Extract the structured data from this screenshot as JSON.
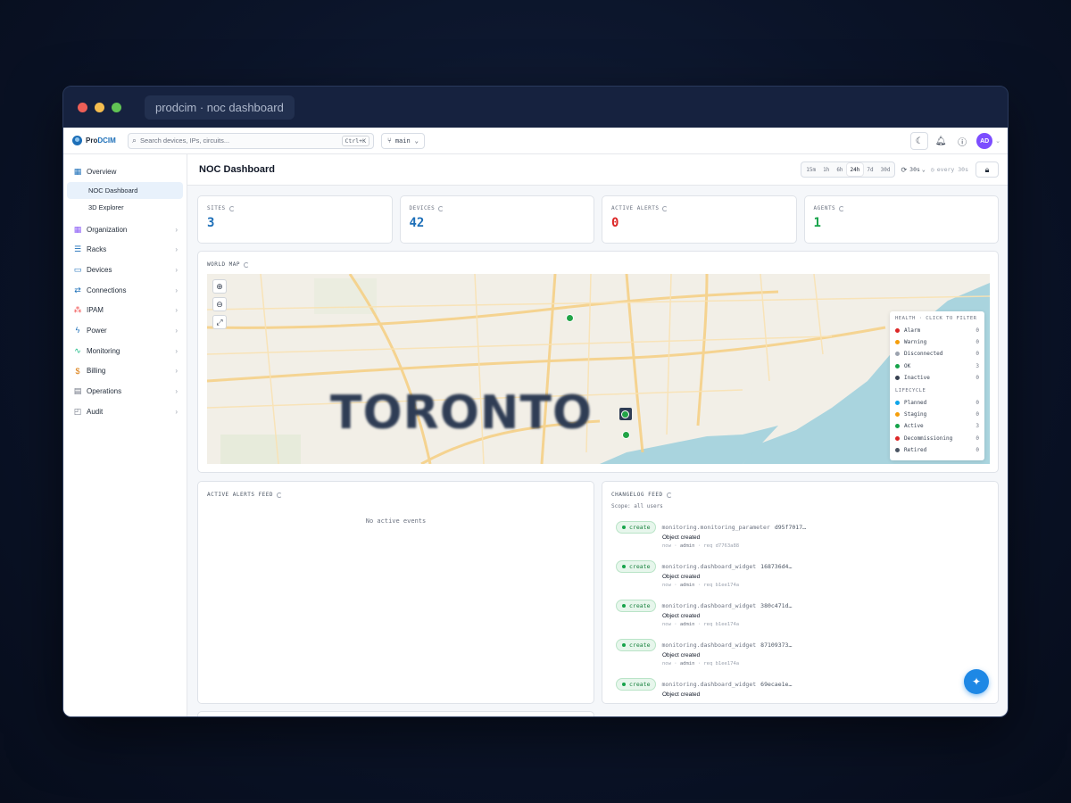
{
  "window": {
    "title": "prodcim · noc dashboard"
  },
  "topbar": {
    "logo_pre": "Pro",
    "logo_post": "DCIM",
    "search_placeholder": "Search devices, IPs, circuits...",
    "search_shortcut": "Ctrl+K",
    "branch": "main",
    "avatar": "AD"
  },
  "sidebar": {
    "overview": "Overview",
    "overview_children": [
      "NOC Dashboard",
      "3D Explorer"
    ],
    "items": [
      {
        "label": "Organization",
        "icon": "building-icon",
        "glyph": "▦",
        "color": "#8b5cf6"
      },
      {
        "label": "Racks",
        "icon": "rack-icon",
        "glyph": "☰",
        "color": "#1d6fb8"
      },
      {
        "label": "Devices",
        "icon": "server-icon",
        "glyph": "▭",
        "color": "#1d6fb8"
      },
      {
        "label": "Connections",
        "icon": "cable-icon",
        "glyph": "⇄",
        "color": "#1d6fb8"
      },
      {
        "label": "IPAM",
        "icon": "network-icon",
        "glyph": "⁂",
        "color": "#ef4444"
      },
      {
        "label": "Power",
        "icon": "bolt-icon",
        "glyph": "ϟ",
        "color": "#1d6fb8"
      },
      {
        "label": "Monitoring",
        "icon": "pulse-icon",
        "glyph": "∿",
        "color": "#10b981"
      },
      {
        "label": "Billing",
        "icon": "billing-icon",
        "glyph": "$",
        "color": "#d97706"
      },
      {
        "label": "Operations",
        "icon": "clipboard-icon",
        "glyph": "▤",
        "color": "#6b7280"
      },
      {
        "label": "Audit",
        "icon": "audit-icon",
        "glyph": "◰",
        "color": "#6b7280"
      }
    ]
  },
  "header": {
    "title": "NOC Dashboard",
    "ranges": [
      "15m",
      "1h",
      "6h",
      "24h",
      "7d",
      "30d"
    ],
    "active_range": "24h",
    "refresh": "30s",
    "every": "every 30s"
  },
  "kpis": [
    {
      "label": "SITES",
      "value": "3",
      "color": "#1d6fb8"
    },
    {
      "label": "DEVICES",
      "value": "42",
      "color": "#1d6fb8"
    },
    {
      "label": "ACTIVE ALERTS",
      "value": "0",
      "color": "#dc2626"
    },
    {
      "label": "AGENTS",
      "value": "1",
      "color": "#16a34a"
    }
  ],
  "map": {
    "title": "WORLD MAP",
    "city_label": "TORONTO",
    "legend": {
      "health_title": "HEALTH · CLICK TO FILTER",
      "health": [
        {
          "label": "Alarm",
          "count": "0",
          "color": "#dc2626"
        },
        {
          "label": "Warning",
          "count": "0",
          "color": "#f59e0b"
        },
        {
          "label": "Disconnected",
          "count": "0",
          "color": "#9ca3af"
        },
        {
          "label": "OK",
          "count": "3",
          "color": "#16a34a"
        },
        {
          "label": "Inactive",
          "count": "0",
          "color": "#374151"
        }
      ],
      "lifecycle_title": "LIFECYCLE",
      "lifecycle": [
        {
          "label": "Planned",
          "count": "0",
          "color": "#0ea5e9"
        },
        {
          "label": "Staging",
          "count": "0",
          "color": "#f59e0b"
        },
        {
          "label": "Active",
          "count": "3",
          "color": "#16a34a"
        },
        {
          "label": "Decommissioning",
          "count": "0",
          "color": "#dc2626"
        },
        {
          "label": "Retired",
          "count": "0",
          "color": "#4b5563"
        }
      ]
    }
  },
  "alerts_feed": {
    "title": "ACTIVE ALERTS FEED",
    "empty": "No active events"
  },
  "changelog": {
    "title": "CHANGELOG FEED",
    "scope": "Scope: all users",
    "entries": [
      {
        "action": "create",
        "object": "monitoring.monitoring_parameter",
        "id": "d95f7017…",
        "message": "Object created",
        "time": "now",
        "user": "admin",
        "req": "req d7763a88"
      },
      {
        "action": "create",
        "object": "monitoring.dashboard_widget",
        "id": "168736d4…",
        "message": "Object created",
        "time": "now",
        "user": "admin",
        "req": "req b1ee174a"
      },
      {
        "action": "create",
        "object": "monitoring.dashboard_widget",
        "id": "380c471d…",
        "message": "Object created",
        "time": "now",
        "user": "admin",
        "req": "req b1ee174a"
      },
      {
        "action": "create",
        "object": "monitoring.dashboard_widget",
        "id": "87109373…",
        "message": "Object created",
        "time": "now",
        "user": "admin",
        "req": "req b1ee174a"
      },
      {
        "action": "create",
        "object": "monitoring.dashboard_widget",
        "id": "69ecae1e…",
        "message": "Object created",
        "time": "",
        "user": "",
        "req": ""
      }
    ]
  }
}
